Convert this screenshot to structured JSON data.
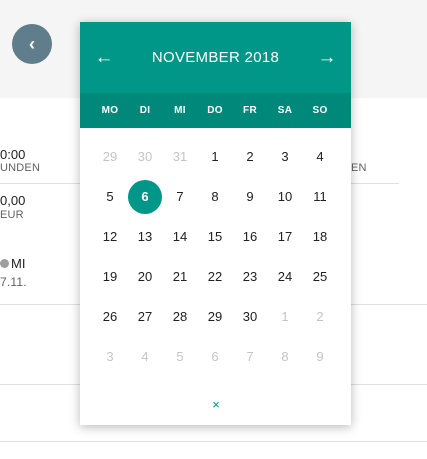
{
  "background": {
    "back_icon": "chevron-left-icon",
    "back_glyph": "‹",
    "left_col": [
      "0:00",
      "UNDEN",
      "0,00",
      "EUR",
      "MI",
      "7.11."
    ],
    "right_col": [
      "EN"
    ]
  },
  "calendar": {
    "prev_glyph": "←",
    "next_glyph": "→",
    "month_title": "NOVEMBER 2018",
    "weekdays": [
      "MO",
      "DI",
      "MI",
      "DO",
      "FR",
      "SA",
      "SO"
    ],
    "weeks": [
      [
        "29",
        "30",
        "31",
        "1",
        "2",
        "3",
        "4"
      ],
      [
        "5",
        "6",
        "7",
        "8",
        "9",
        "10",
        "11"
      ],
      [
        "12",
        "13",
        "14",
        "15",
        "16",
        "17",
        "18"
      ],
      [
        "19",
        "20",
        "21",
        "22",
        "23",
        "24",
        "25"
      ],
      [
        "26",
        "27",
        "28",
        "29",
        "30",
        "1",
        "2"
      ],
      [
        "3",
        "4",
        "5",
        "6",
        "7",
        "8",
        "9"
      ]
    ],
    "out_of_month": [
      [
        0,
        0
      ],
      [
        0,
        1
      ],
      [
        0,
        2
      ],
      [
        4,
        5
      ],
      [
        4,
        6
      ],
      [
        5,
        0
      ],
      [
        5,
        1
      ],
      [
        5,
        2
      ],
      [
        5,
        3
      ],
      [
        5,
        4
      ],
      [
        5,
        5
      ],
      [
        5,
        6
      ]
    ],
    "selected": [
      1,
      1
    ],
    "close_glyph": "×",
    "accent_color": "#009688",
    "weekday_bar_color": "#00897b"
  }
}
